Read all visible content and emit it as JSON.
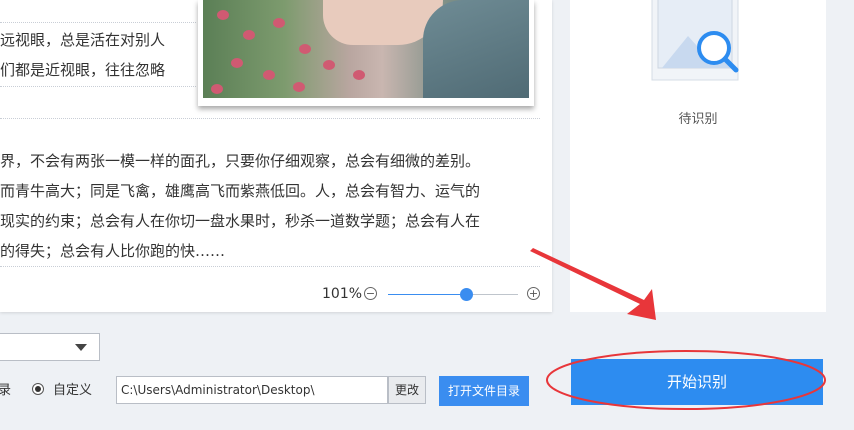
{
  "document": {
    "top_lines": [
      "远视眼，总是活在对别人",
      "们都是近视眼，往往忽略"
    ],
    "body_lines": [
      "界，不会有两张一模一样的面孔，只要你仔细观察，总会有细微的差别。",
      "而青牛高大；同是飞禽，雄鹰高飞而紫燕低回。人，总会有智力、运气的",
      "现实的约束；总会有人在你切一盘水果时，秒杀一道数学题；总会有人在",
      "的得失；总会有人比你跑的快……"
    ],
    "photo_icon": "photo-image"
  },
  "zoom": {
    "level_label": "101%",
    "level_fraction": 0.6,
    "minus_icon": "minus-circle-icon",
    "plus_icon": "plus-circle-icon"
  },
  "result": {
    "status": "待识别",
    "icon": "image-search-icon"
  },
  "output": {
    "left_partial_label": "录",
    "custom_label": "自定义",
    "path_value": "C:\\Users\\Administrator\\Desktop\\",
    "change_label": "更改",
    "open_folder_label": "打开文件目录"
  },
  "start_button": {
    "label": "开始识别"
  },
  "colors": {
    "accent": "#3a8df0",
    "start_button": "#2d8cf0",
    "annotation": "#e8363a",
    "background": "#eef1f5"
  }
}
